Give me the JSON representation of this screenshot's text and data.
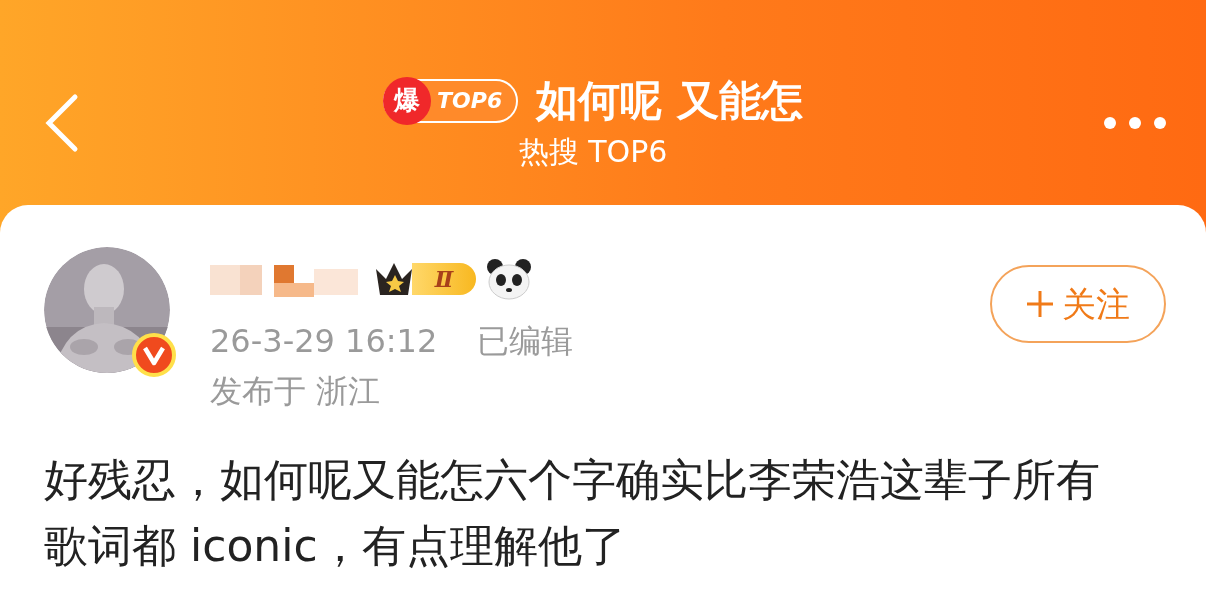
{
  "header": {
    "hot_badge": {
      "icon_text": "爆",
      "label": "TOP6"
    },
    "title": "如何呢 又能怎",
    "subtitle": "热搜 TOP6"
  },
  "post": {
    "author": {
      "verified": true,
      "level_badge": "Ⅱ"
    },
    "timestamp": "26-3-29 16:12",
    "edited_label": "已编辑",
    "location": "发布于 浙江",
    "follow_button": {
      "label": "关注"
    },
    "body": "好残忍，如何呢又能怎六个字确实比李荣浩这辈子所有歌词都 iconic，有点理解他了"
  }
}
